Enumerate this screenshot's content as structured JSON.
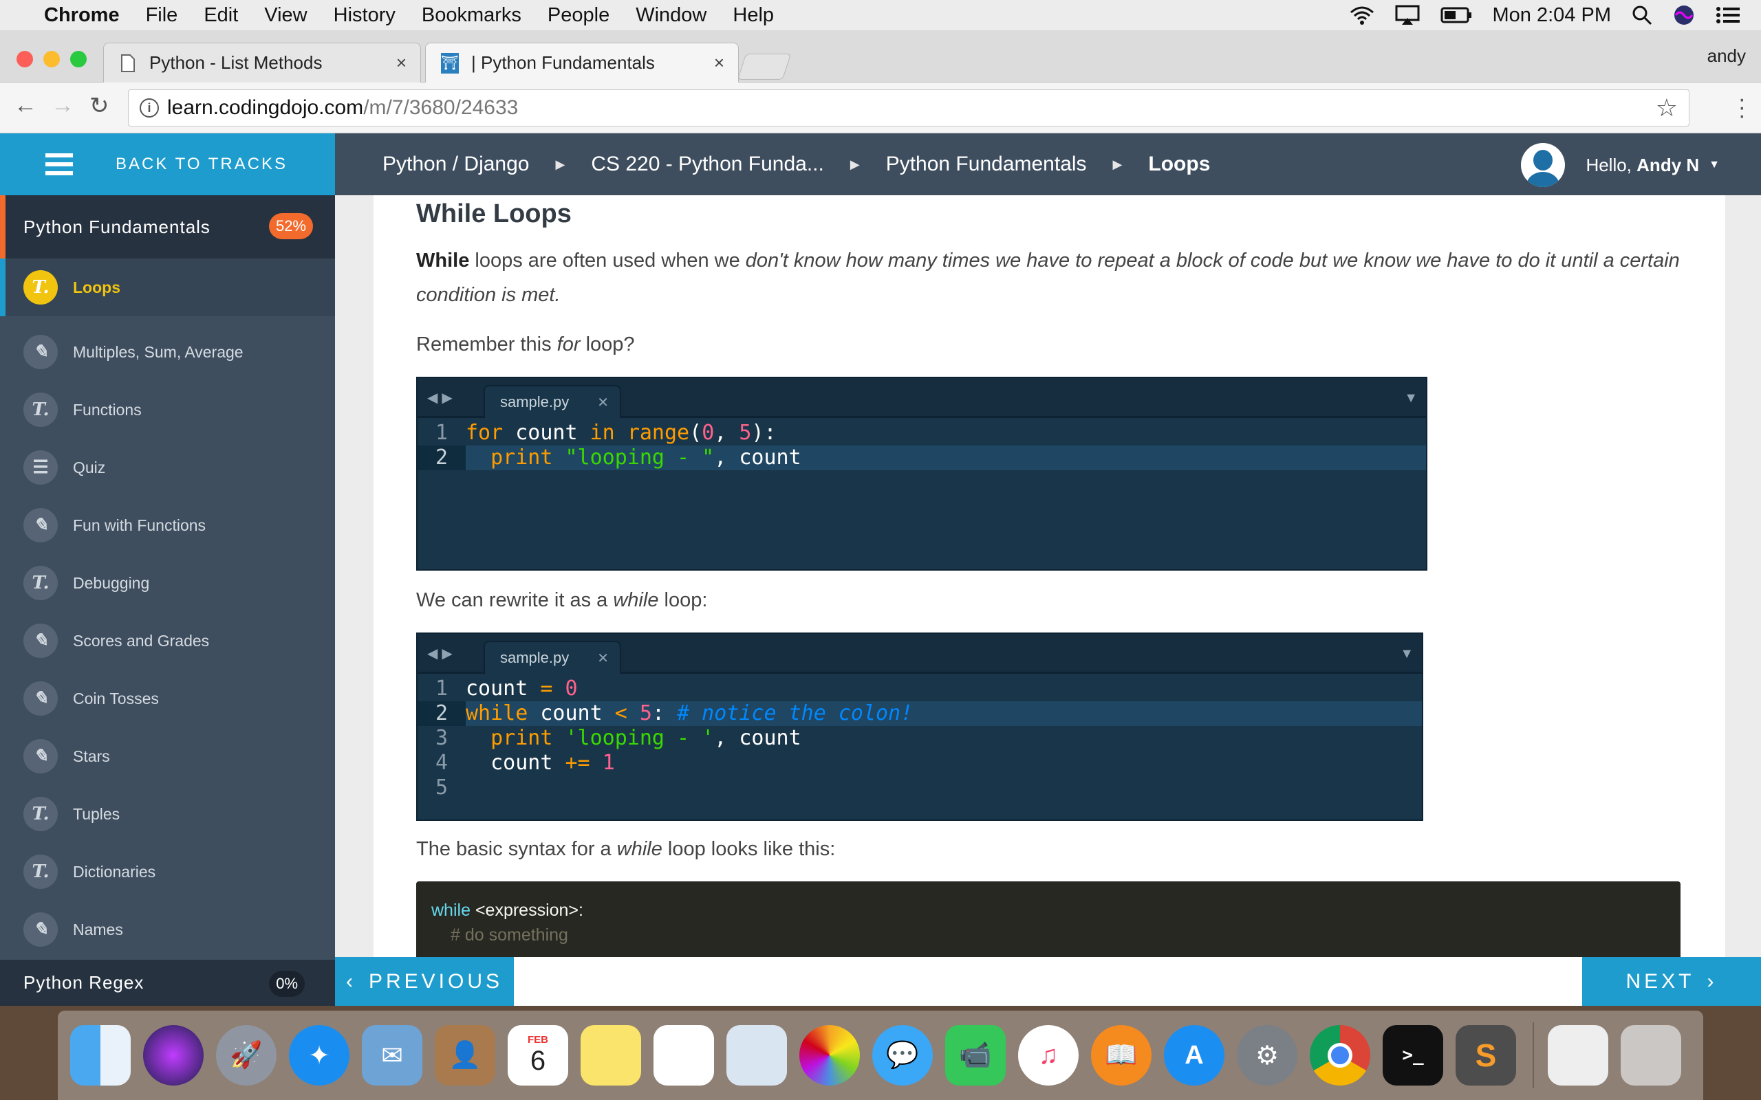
{
  "menubar": {
    "app": "Chrome",
    "items": [
      "File",
      "Edit",
      "View",
      "History",
      "Bookmarks",
      "People",
      "Window",
      "Help"
    ],
    "clock": "Mon 2:04 PM"
  },
  "browser": {
    "tabs": [
      {
        "title": "Python - List Methods"
      },
      {
        "title": "| Python Fundamentals"
      }
    ],
    "profile": "andy",
    "url_host": "learn.codingdojo.com",
    "url_path": "/m/7/3680/24633"
  },
  "header": {
    "back_label": "BACK TO TRACKS",
    "breadcrumbs": [
      "Python / Django",
      "CS 220 - Python Funda...",
      "Python Fundamentals",
      "Loops"
    ],
    "greeting": "Hello,",
    "user_name": "Andy N"
  },
  "sidebar": {
    "section": "Python Fundamentals",
    "section_progress": "52%",
    "items": [
      {
        "label": "Loops",
        "icon": "T."
      },
      {
        "label": "Multiples, Sum, Average",
        "icon": "✎"
      },
      {
        "label": "Functions",
        "icon": "T."
      },
      {
        "label": "Quiz",
        "icon": "☰"
      },
      {
        "label": "Fun with Functions",
        "icon": "✎"
      },
      {
        "label": "Debugging",
        "icon": "T."
      },
      {
        "label": "Scores and Grades",
        "icon": "✎"
      },
      {
        "label": "Coin Tosses",
        "icon": "✎"
      },
      {
        "label": "Stars",
        "icon": "✎"
      },
      {
        "label": "Tuples",
        "icon": "T."
      },
      {
        "label": "Dictionaries",
        "icon": "T."
      },
      {
        "label": "Names",
        "icon": "✎"
      }
    ],
    "next_section": "Python Regex",
    "next_section_progress": "0%"
  },
  "content": {
    "title": "While Loops",
    "intro_bold": "While",
    "intro_text": " loops are often used when we ",
    "intro_italic": "don't know how many times we have to repeat a block of code but we know we have to do it until a certain condition is met.",
    "remember_a": "Remember this ",
    "remember_i": "for",
    "remember_b": " loop?",
    "rewrite_a": "We can rewrite it as a ",
    "rewrite_i": "while",
    "rewrite_b": " loop:",
    "syntax_a": "The basic syntax for a ",
    "syntax_i": "while",
    "syntax_b": " loop looks like this:",
    "editor_file": "sample.py",
    "syntax_kw": "while",
    "syntax_expr": "<expression>:",
    "syntax_comment": "# do something"
  },
  "nav": {
    "previous": "PREVIOUS",
    "next": "NEXT"
  },
  "dock": {
    "calendar_month": "FEB",
    "calendar_day": "6"
  },
  "colors": {
    "accent": "#1e9ccd",
    "header": "#3f4e5f",
    "progress": "#f26b2d",
    "active_item": "#f1c40f"
  }
}
